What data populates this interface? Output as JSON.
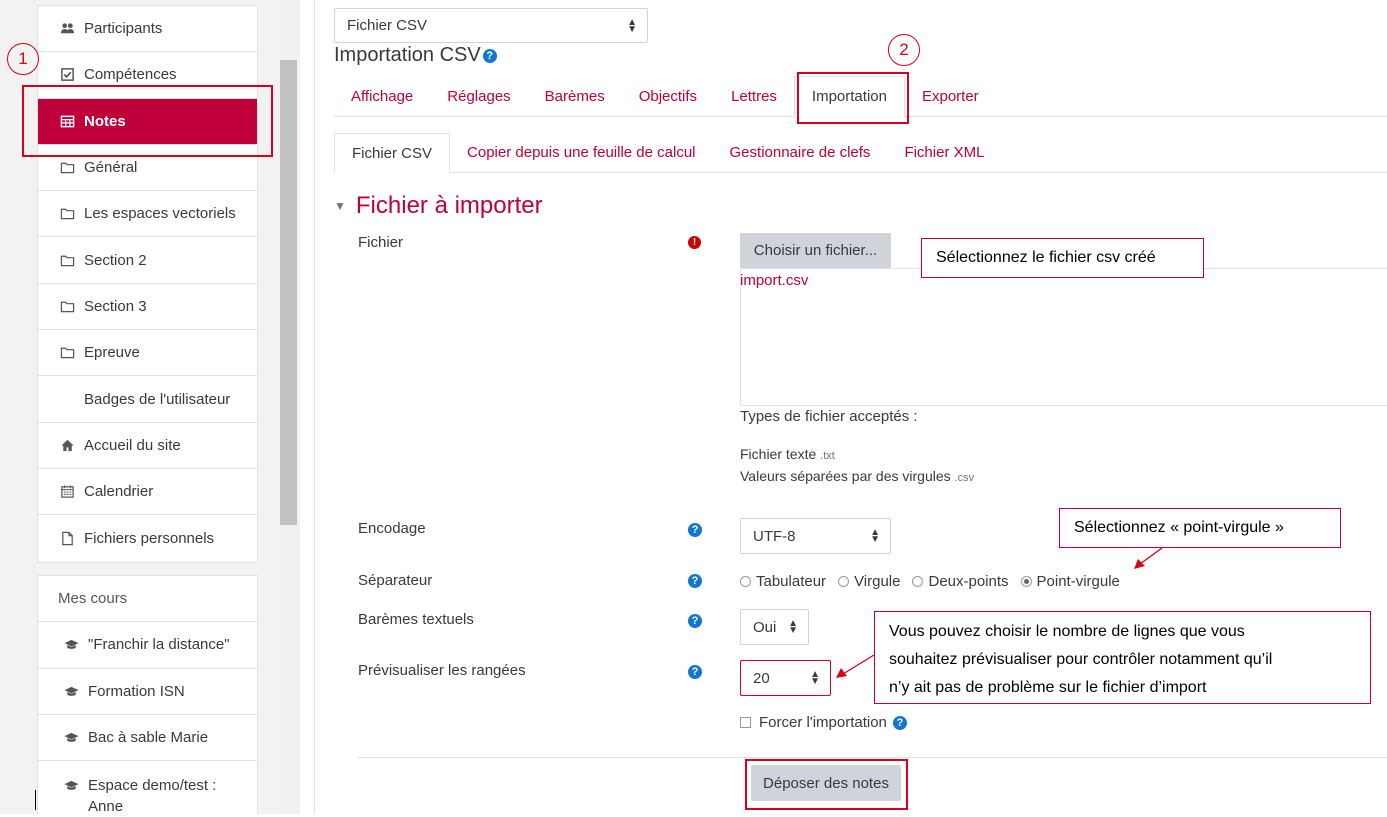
{
  "sidebar": {
    "items": [
      {
        "label": "Participants",
        "icon": "users-icon"
      },
      {
        "label": "Compétences",
        "icon": "check-square-icon"
      },
      {
        "label": "Notes",
        "icon": "table-icon"
      },
      {
        "label": "Général",
        "icon": "folder-icon"
      },
      {
        "label": "Les espaces vectoriels",
        "icon": "folder-icon"
      },
      {
        "label": "Section 2",
        "icon": "folder-icon"
      },
      {
        "label": "Section 3",
        "icon": "folder-icon"
      },
      {
        "label": "Epreuve",
        "icon": "folder-icon"
      },
      {
        "label": "Badges de l'utilisateur",
        "icon": ""
      },
      {
        "label": "Accueil du site",
        "icon": "home-icon"
      },
      {
        "label": "Calendrier",
        "icon": "calendar-icon"
      },
      {
        "label": "Fichiers personnels",
        "icon": "file-icon"
      }
    ],
    "courses_header": "Mes cours",
    "courses": [
      {
        "label": "\"Franchir la distance\""
      },
      {
        "label": "Formation ISN"
      },
      {
        "label": "Bac à sable Marie"
      },
      {
        "label": "Espace demo/test : Anne",
        "line1": "Espace demo/test :",
        "line2": "Anne"
      }
    ]
  },
  "top_select": {
    "value": "Fichier CSV"
  },
  "page_title": "Importation CSV",
  "main_tabs": [
    "Affichage",
    "Réglages",
    "Barèmes",
    "Objectifs",
    "Lettres",
    "Importation",
    "Exporter"
  ],
  "sub_tabs": [
    "Fichier CSV",
    "Copier depuis une feuille de calcul",
    "Gestionnaire de clefs",
    "Fichier XML"
  ],
  "section": {
    "title": "Fichier à importer"
  },
  "form": {
    "file_label": "Fichier",
    "choose_button": "Choisir un fichier...",
    "selected_file": "import.csv",
    "accepted_types_label": "Types de fichier acceptés :",
    "type1_name": "Fichier texte",
    "type1_ext": ".txt",
    "type2_name": "Valeurs séparées par des virgules",
    "type2_ext": ".csv",
    "encoding_label": "Encodage",
    "encoding_value": "UTF-8",
    "separator_label": "Séparateur",
    "separator_options": [
      "Tabulateur",
      "Virgule",
      "Deux-points",
      "Point-virgule"
    ],
    "separator_selected": "Point-virgule",
    "scales_label": "Barèmes textuels",
    "scales_value": "Oui",
    "preview_label": "Prévisualiser les rangées",
    "preview_value": "20",
    "force_label": "Forcer l'importation",
    "submit_button": "Déposer des notes"
  },
  "annotations": {
    "step1": "1",
    "step2": "2",
    "callout_file": "Sélectionnez le fichier csv créé",
    "callout_separator": "Sélectionnez « point-virgule »",
    "callout_preview_l1": "Vous pouvez choisir le nombre de lignes que vous",
    "callout_preview_l2": "souhaitez prévisualiser pour contrôler notamment qu’il",
    "callout_preview_l3": "n’y ait pas de problème sur le fichier d’import"
  },
  "colors": {
    "accent": "#c0003b",
    "annotation_red": "#d9001b",
    "help_blue": "#1177d1"
  }
}
